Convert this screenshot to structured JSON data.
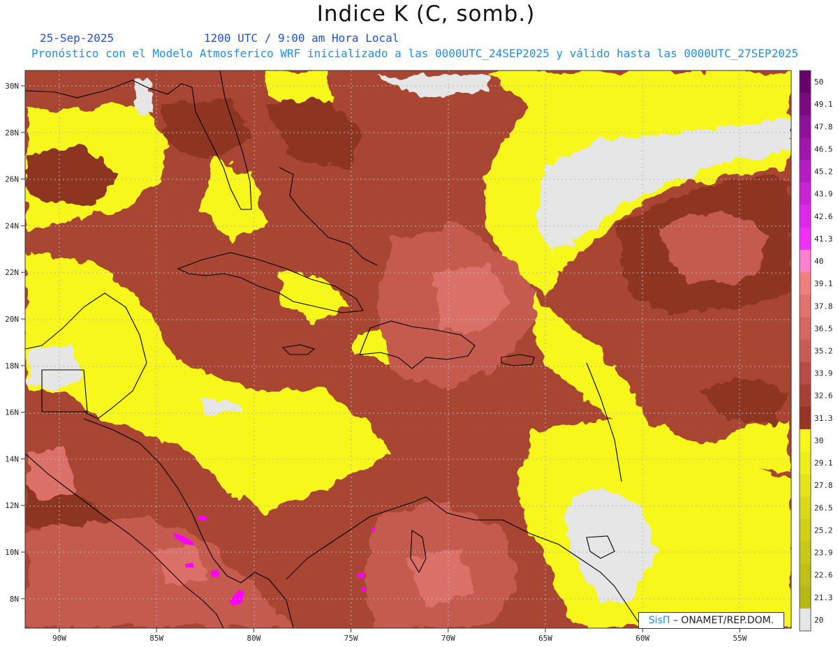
{
  "header": {
    "title": "Indice K (C, somb.)",
    "date": "25-Sep-2025",
    "time": "1200 UTC / 9:00 am Hora Local",
    "description": "Pronóstico con el Modelo Atmosferico WRF inicializado a las 0000UTC_24SEP2025 y válido hasta las  0000UTC_27SEP2025"
  },
  "map": {
    "lat_ticks": [
      "30N",
      "28N",
      "26N",
      "24N",
      "22N",
      "20N",
      "18N",
      "16N",
      "14N",
      "12N",
      "10N",
      "8N"
    ],
    "lon_ticks": [
      "90W",
      "85W",
      "80W",
      "75W",
      "70W",
      "65W",
      "60W",
      "55W"
    ],
    "colors": {
      "missing": "#e6e6e6",
      "yellow": "#f7f71a",
      "dark_brown": "#8e3420",
      "mid_brown": "#a84533",
      "salmon": "#c55a50",
      "pink": "#db6f68",
      "magenta": "#ff00ff"
    }
  },
  "colorbar": {
    "labels": [
      "50",
      "49.1",
      "47.8",
      "46.5",
      "45.2",
      "43.9",
      "42.6",
      "41.3",
      "40",
      "39.1",
      "37.8",
      "36.5",
      "35.2",
      "33.9",
      "32.6",
      "31.3",
      "30",
      "29.1",
      "27.8",
      "26.5",
      "25.2",
      "23.9",
      "22.6",
      "21.3",
      "20"
    ],
    "colors": [
      "#66006a",
      "#7a0a80",
      "#8e1096",
      "#a216ac",
      "#b61cc2",
      "#ca22d8",
      "#de28ee",
      "#f030f8",
      "#ff80d0",
      "#f08080",
      "#e07470",
      "#d46864",
      "#c85c58",
      "#b84c46",
      "#a84034",
      "#983424",
      "#f7f71a",
      "#eeee1a",
      "#e4e41a",
      "#dada1a",
      "#d0d018",
      "#c8c818",
      "#c0c016",
      "#b8b814",
      "#e6e6e6"
    ]
  },
  "credit": {
    "brand": "SisΠ",
    "text": "– ONAMET/REP.DOM."
  }
}
